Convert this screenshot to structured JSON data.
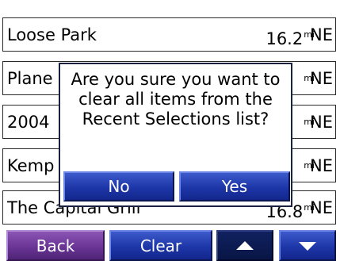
{
  "list": {
    "items": [
      {
        "name": "Loose Park",
        "distance": "16.2",
        "unit": "mi",
        "direction": "NE"
      },
      {
        "name": "Plane",
        "distance": "",
        "unit": "mi",
        "direction": "NE"
      },
      {
        "name": "2004",
        "distance": "",
        "unit": "mi",
        "direction": "NE"
      },
      {
        "name": "Kemp",
        "distance": "",
        "unit": "mi",
        "direction": "NE"
      },
      {
        "name": "The Capital Grill",
        "distance": "16.8",
        "unit": "mi",
        "direction": "NE"
      }
    ]
  },
  "dialog": {
    "message": "Are you sure you want to clear all items from the Recent Selections list?",
    "no_label": "No",
    "yes_label": "Yes"
  },
  "bottom_bar": {
    "back_label": "Back",
    "clear_label": "Clear",
    "up_icon": "triangle-up-icon",
    "down_icon": "triangle-down-icon"
  },
  "colors": {
    "button_blue": "#1d36a8",
    "button_purple": "#6a3596",
    "button_dark": "#081545"
  }
}
